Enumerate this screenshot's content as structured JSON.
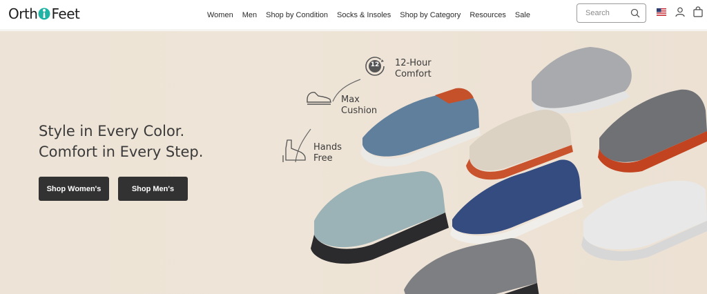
{
  "brand": {
    "name_left": "Orth",
    "name_right": "Feet"
  },
  "nav": {
    "items": [
      "Women",
      "Men",
      "Shop by Condition",
      "Socks & Insoles",
      "Shop by Category",
      "Resources",
      "Sale"
    ]
  },
  "search": {
    "placeholder": "Search"
  },
  "icons": {
    "flag": "us-flag-icon",
    "account": "user-icon",
    "cart": "shopping-bag-icon",
    "search": "search-icon"
  },
  "hero": {
    "headline_line1": "Style in Every Color.",
    "headline_line2": "Comfort in Every Step.",
    "button_women": "Shop Women's",
    "button_men": "Shop Men's",
    "features": {
      "badge": "12",
      "comfort_line1": "12-Hour",
      "comfort_line2": "Comfort",
      "cushion_line1": "Max",
      "cushion_line2": "Cushion",
      "hands_line1": "Hands",
      "hands_line2": "Free"
    }
  },
  "colors": {
    "button_bg": "#333232",
    "hero_bg": "#ede3d6",
    "text_dark": "#3a3a3a"
  }
}
